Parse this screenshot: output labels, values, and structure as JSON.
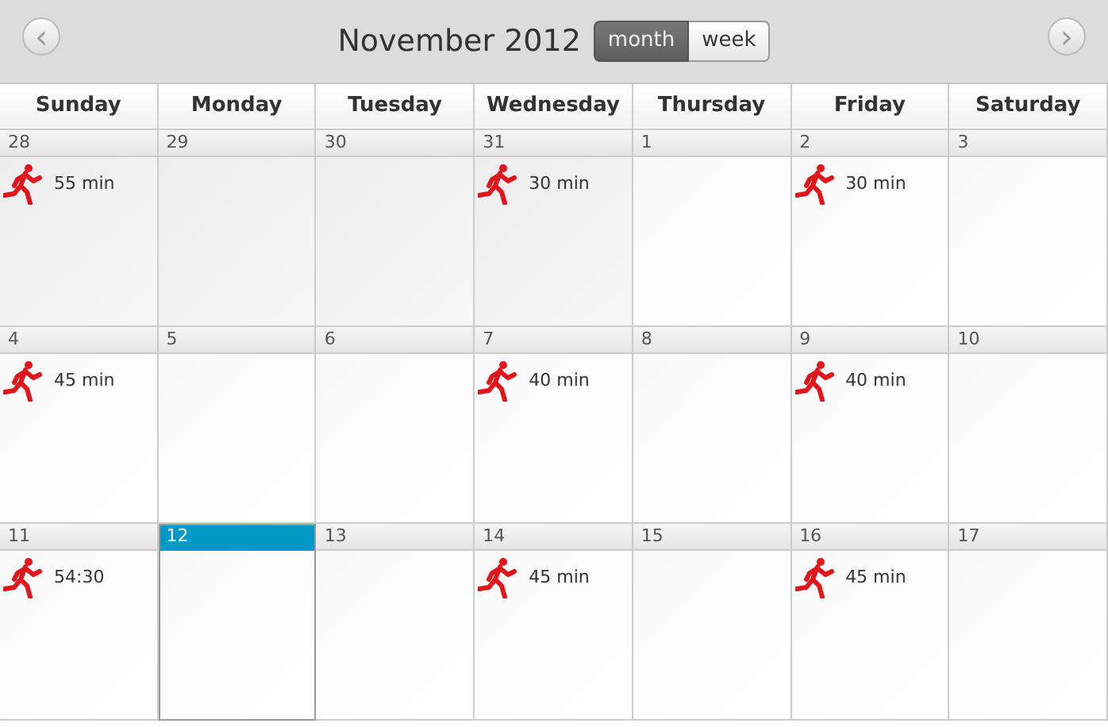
{
  "header": {
    "prev": "‹",
    "title": "November 2012",
    "next": "›",
    "views": [
      {
        "label": "month",
        "selected": true
      },
      {
        "label": "week",
        "selected": false
      }
    ]
  },
  "weekdays": [
    "Sunday",
    "Monday",
    "Tuesday",
    "Wednesday",
    "Thursday",
    "Friday",
    "Saturday"
  ],
  "weeks": [
    [
      {
        "day": "28",
        "other_month": true,
        "today": false,
        "event": "55 min"
      },
      {
        "day": "29",
        "other_month": true,
        "today": false
      },
      {
        "day": "30",
        "other_month": true,
        "today": false
      },
      {
        "day": "31",
        "other_month": true,
        "today": false,
        "event": "30 min"
      },
      {
        "day": "1",
        "other_month": false,
        "today": false
      },
      {
        "day": "2",
        "other_month": false,
        "today": false,
        "event": "30 min"
      },
      {
        "day": "3",
        "other_month": false,
        "today": false
      }
    ],
    [
      {
        "day": "4",
        "other_month": false,
        "today": false,
        "event": "45 min"
      },
      {
        "day": "5",
        "other_month": false,
        "today": false
      },
      {
        "day": "6",
        "other_month": false,
        "today": false
      },
      {
        "day": "7",
        "other_month": false,
        "today": false,
        "event": "40 min"
      },
      {
        "day": "8",
        "other_month": false,
        "today": false
      },
      {
        "day": "9",
        "other_month": false,
        "today": false,
        "event": "40 min"
      },
      {
        "day": "10",
        "other_month": false,
        "today": false
      }
    ],
    [
      {
        "day": "11",
        "other_month": false,
        "today": false,
        "event": "54:30"
      },
      {
        "day": "12",
        "other_month": false,
        "today": true
      },
      {
        "day": "13",
        "other_month": false,
        "today": false
      },
      {
        "day": "14",
        "other_month": false,
        "today": false,
        "event": "45 min"
      },
      {
        "day": "15",
        "other_month": false,
        "today": false
      },
      {
        "day": "16",
        "other_month": false,
        "today": false,
        "event": "45 min"
      },
      {
        "day": "17",
        "other_month": false,
        "today": false
      }
    ]
  ]
}
